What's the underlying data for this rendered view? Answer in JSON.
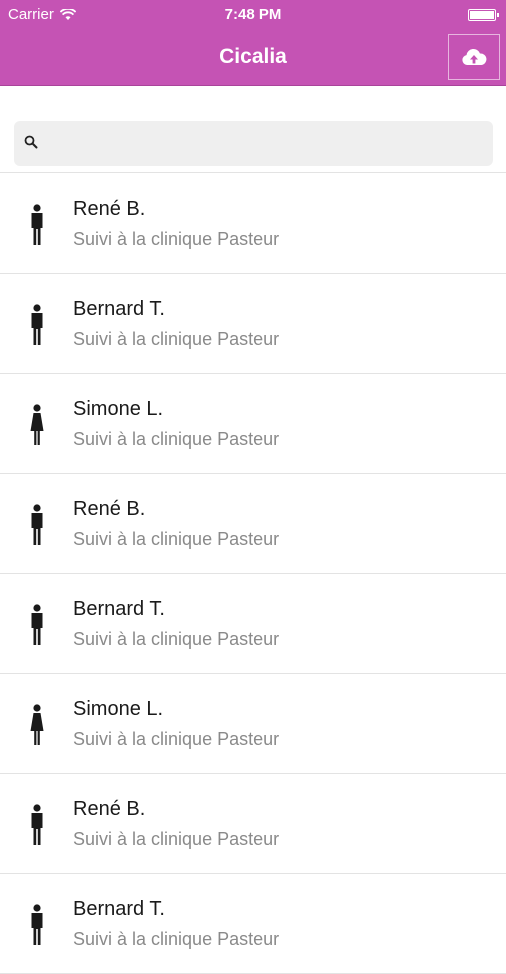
{
  "status_bar": {
    "carrier": "Carrier",
    "time": "7:48 PM",
    "wifi_icon": "wifi-icon",
    "battery_icon": "battery-icon"
  },
  "nav": {
    "title": "Cicalia",
    "upload_icon": "cloud-upload-icon",
    "accent_color": "#c553b4"
  },
  "search": {
    "placeholder": "",
    "value": "",
    "icon": "search-icon"
  },
  "patients": [
    {
      "name": "René B.",
      "subtitle": "Suivi à la clinique Pasteur",
      "gender": "male"
    },
    {
      "name": "Bernard T.",
      "subtitle": "Suivi à la clinique Pasteur",
      "gender": "male"
    },
    {
      "name": "Simone L.",
      "subtitle": "Suivi à la clinique Pasteur",
      "gender": "female"
    },
    {
      "name": "René B.",
      "subtitle": "Suivi à la clinique Pasteur",
      "gender": "male"
    },
    {
      "name": "Bernard T.",
      "subtitle": "Suivi à la clinique Pasteur",
      "gender": "male"
    },
    {
      "name": "Simone L.",
      "subtitle": "Suivi à la clinique Pasteur",
      "gender": "female"
    },
    {
      "name": "René B.",
      "subtitle": "Suivi à la clinique Pasteur",
      "gender": "male"
    },
    {
      "name": "Bernard T.",
      "subtitle": "Suivi à la clinique Pasteur",
      "gender": "male"
    }
  ]
}
